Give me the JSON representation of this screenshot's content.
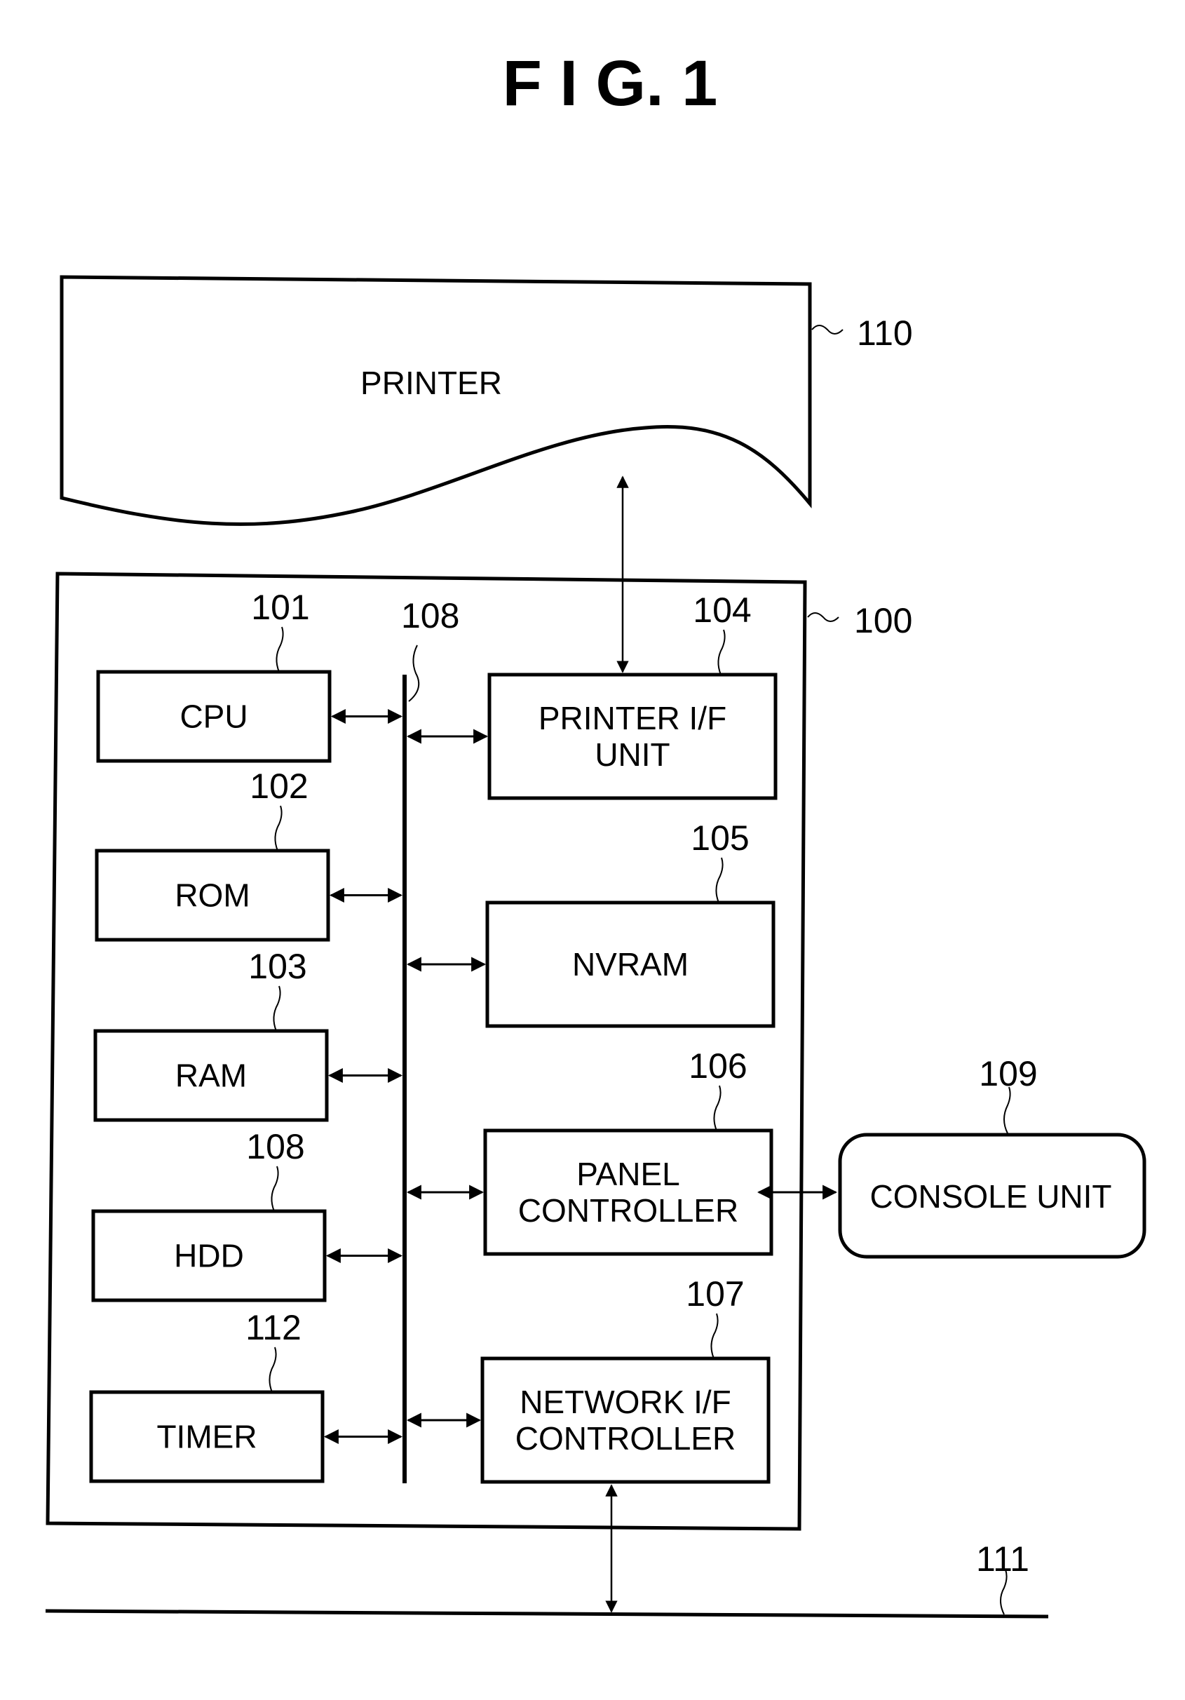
{
  "figure": {
    "title": "F I G.  1"
  },
  "printer": {
    "label": "PRINTER",
    "ref": "110"
  },
  "controller": {
    "ref": "100"
  },
  "bus": {
    "ref": "108"
  },
  "left_blocks": [
    {
      "label": "CPU",
      "ref": "101"
    },
    {
      "label": "ROM",
      "ref": "102"
    },
    {
      "label": "RAM",
      "ref": "103"
    },
    {
      "label": "HDD",
      "ref": "108"
    },
    {
      "label": "TIMER",
      "ref": "112"
    }
  ],
  "right_blocks": [
    {
      "lines": [
        "PRINTER I/F",
        "UNIT"
      ],
      "ref": "104"
    },
    {
      "lines": [
        "NVRAM"
      ],
      "ref": "105"
    },
    {
      "lines": [
        "PANEL",
        "CONTROLLER"
      ],
      "ref": "106"
    },
    {
      "lines": [
        "NETWORK I/F",
        "CONTROLLER"
      ],
      "ref": "107"
    }
  ],
  "console": {
    "label": "CONSOLE UNIT",
    "ref": "109"
  },
  "network": {
    "ref": "111"
  }
}
